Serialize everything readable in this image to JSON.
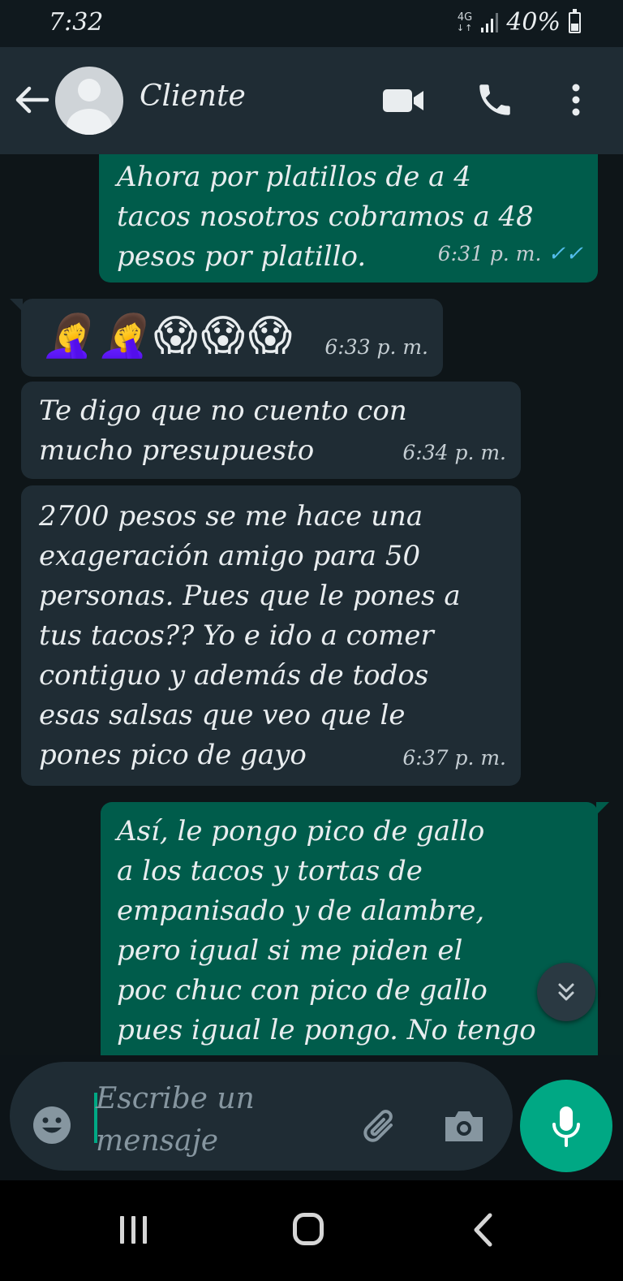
{
  "status_bar": {
    "time": "7:32",
    "network": "4G",
    "network_arrows": "↓↑",
    "battery_percent": "40%",
    "battery_level": 0.4
  },
  "header": {
    "contact_name": "Cliente"
  },
  "messages": [
    {
      "direction": "out",
      "text": "Ahora por platillos de a 4\ntacos nosotros cobramos a 48\npesos por platillo.",
      "time": "6:31 p. m.",
      "status": "read",
      "ticks": "✓✓"
    },
    {
      "direction": "in",
      "emojis": [
        "🤦‍♀️",
        "🤦‍♀️",
        "😱",
        "😱",
        "😱"
      ],
      "time": "6:33 p. m."
    },
    {
      "direction": "in",
      "text": "Te digo que no cuento con\nmucho presupuesto",
      "time": "6:34 p. m."
    },
    {
      "direction": "in",
      "text": "2700 pesos se me hace una\nexageración amigo para 50\npersonas. Pues que le pones a\ntus tacos?? Yo e ido a comer\ncontiguo y además de todos\nesas salsas que veo que le\npones pico de gayo",
      "time": "6:37 p. m."
    },
    {
      "direction": "out",
      "text": "Así, le pongo pico de gallo\na los tacos y tortas de\nempanisado y de alambre,\npero igual si me piden el\npoc chuc con pico de gallo\npues igual le pongo. No tengo"
    }
  ],
  "composer": {
    "placeholder": "Escribe un mensaje"
  },
  "colors": {
    "outgoing_bubble": "#005c4b",
    "incoming_bubble": "#1f2c34",
    "accent": "#00a884",
    "read_ticks": "#53bdeb",
    "header": "#1f2c34"
  },
  "icons": {
    "back": "arrow-left-icon",
    "video": "video-camera-icon",
    "call": "phone-icon",
    "menu": "more-vertical-icon",
    "emoji": "emoji-smile-icon",
    "attach": "paperclip-icon",
    "camera": "camera-icon",
    "mic": "microphone-icon",
    "scroll": "double-chevron-down-icon"
  }
}
